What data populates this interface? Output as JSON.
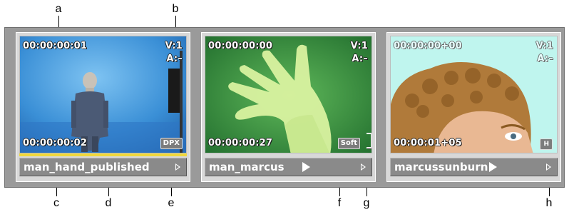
{
  "callouts": {
    "top": [
      "a",
      "b"
    ],
    "bottom": [
      "c",
      "d",
      "e",
      "f",
      "g",
      "h"
    ]
  },
  "clips": [
    {
      "name": "man_hand_published",
      "timecode_top": "00:00:00:01",
      "timecode_bottom": "00:00:00:02",
      "video_track": "V:1",
      "audio_track": "A:–",
      "badge": "DPX",
      "selected": true,
      "selection_color": "#f0d83a"
    },
    {
      "name": "man_marcus",
      "timecode_top": "00:00:00:00",
      "timecode_bottom": "00:00:00:27",
      "video_track": "V:1",
      "audio_track": "A:–",
      "badge": "Soft",
      "selected": false
    },
    {
      "name": "marcussunburn",
      "timecode_top": "00:00:00+00",
      "timecode_bottom": "00:00:01+05",
      "video_track": "V:1",
      "audio_track": "A:–",
      "badge": "H",
      "selected": false
    }
  ],
  "icons": {
    "play": "play-triangle-icon",
    "menu": "menu-triangle-icon",
    "trim": "trim-bracket-icon"
  },
  "colors": {
    "bin_background": "#9a9a9a",
    "namebar": "#8a8a8a",
    "timecode_text": "#ffffff"
  }
}
